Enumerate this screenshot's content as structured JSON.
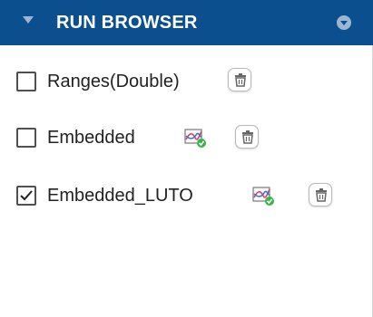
{
  "header": {
    "title": "RUN BROWSER",
    "collapse_icon": "triangle-down-icon",
    "menu_icon": "circle-chevron-down-icon",
    "bg_color": "#0b4f8f"
  },
  "runs": [
    {
      "label": "Ranges(Double)",
      "checked": false,
      "has_plot_icon": false
    },
    {
      "label": "Embedded",
      "checked": false,
      "has_plot_icon": true
    },
    {
      "label": "Embedded_LUTO",
      "checked": true,
      "has_plot_icon": true
    }
  ],
  "icons": {
    "delete": "trash-icon",
    "plot": "plot-compare-icon"
  }
}
